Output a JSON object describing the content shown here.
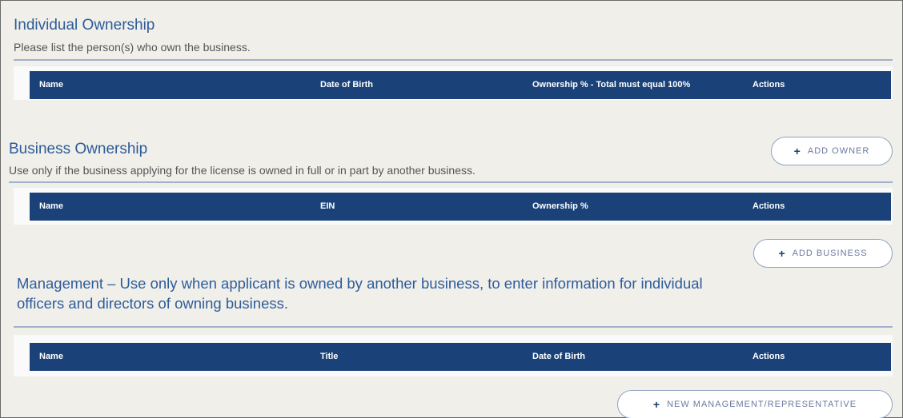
{
  "individual": {
    "title": "Individual Ownership",
    "subtitle": "Please list the person(s) who own the business.",
    "columns": [
      "Name",
      "Date of Birth",
      "Ownership % - Total must equal 100%",
      "Actions"
    ],
    "add_label": "ADD OWNER",
    "add_icon": "plus-icon"
  },
  "business": {
    "title": "Business Ownership",
    "subtitle": "Use only if the business applying for the license is owned in full or in part by another business.",
    "columns": [
      "Name",
      "EIN",
      "Ownership %",
      "Actions"
    ],
    "add_label": "ADD BUSINESS",
    "add_icon": "plus-icon"
  },
  "management": {
    "title_line1": "Management – Use only when applicant is owned by another business, to enter information for individual",
    "title_line2": "officers and directors of owning business.",
    "columns": [
      "Name",
      "Title",
      "Date of Birth",
      "Actions"
    ],
    "add_label": "NEW MANAGEMENT/REPRESENTATIVE",
    "add_icon": "plus-icon"
  },
  "colors": {
    "header_bg": "#1a4279",
    "title": "#2e5c9a",
    "panel_bg": "#f0efea"
  }
}
